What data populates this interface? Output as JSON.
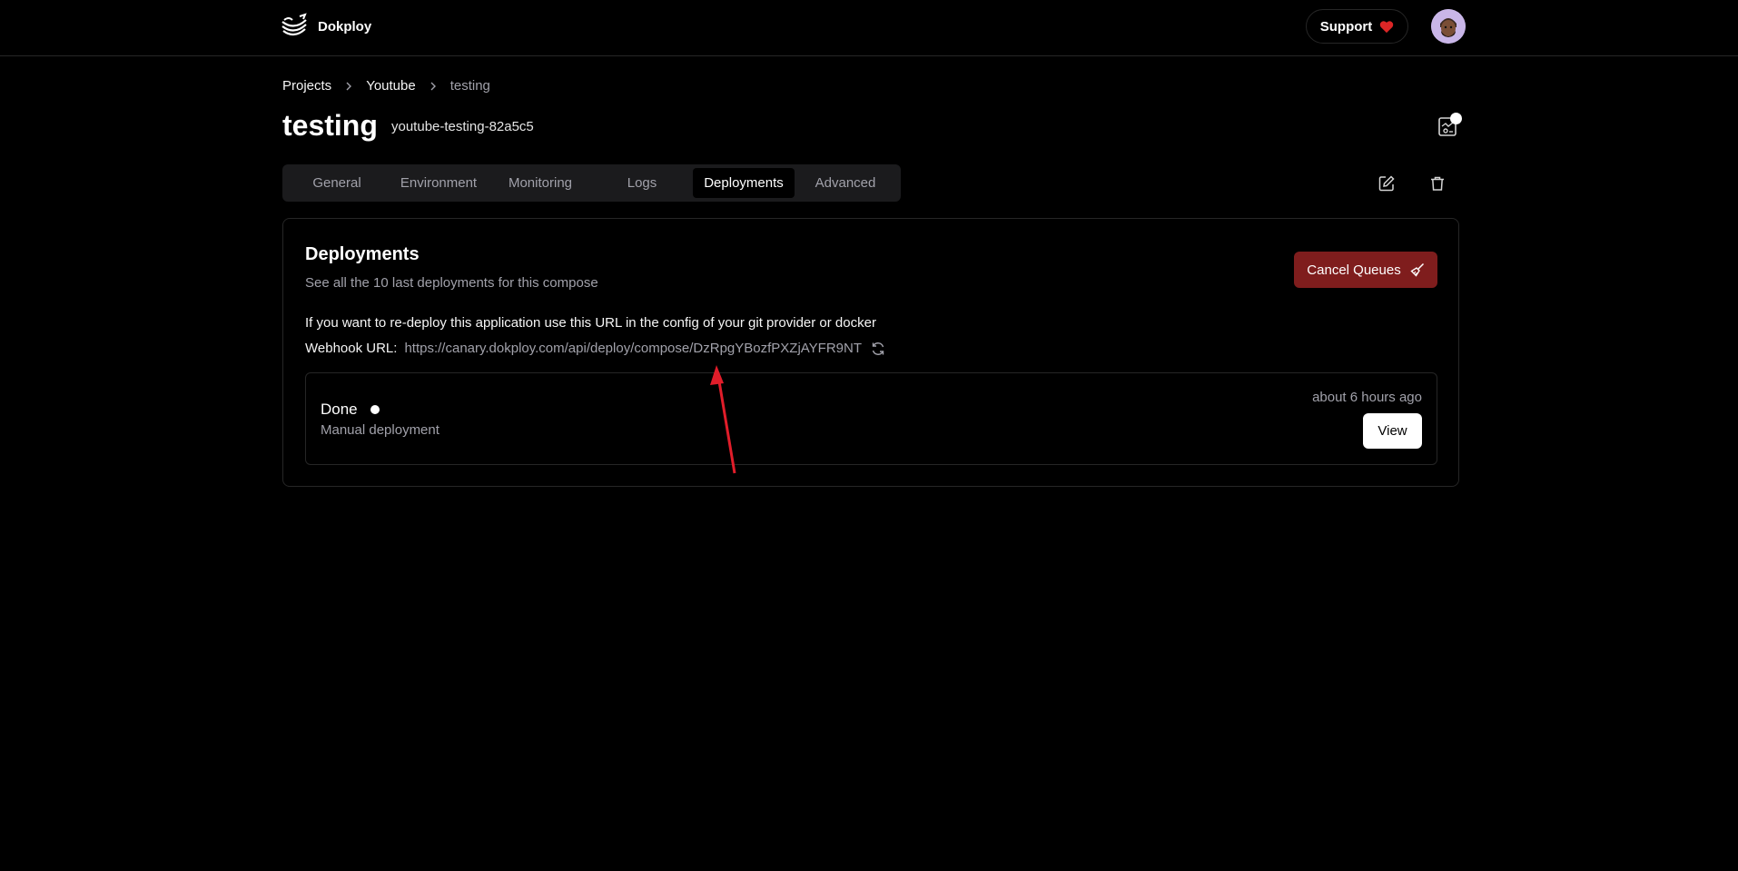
{
  "header": {
    "brand_name": "Dokploy",
    "support_label": "Support"
  },
  "breadcrumb": [
    {
      "label": "Projects"
    },
    {
      "label": "Youtube"
    },
    {
      "label": "testing"
    }
  ],
  "page": {
    "title": "testing",
    "app_name": "youtube-testing-82a5c5"
  },
  "tabs": [
    {
      "label": "General"
    },
    {
      "label": "Environment"
    },
    {
      "label": "Monitoring"
    },
    {
      "label": "Logs"
    },
    {
      "label": "Deployments",
      "active": true
    },
    {
      "label": "Advanced"
    }
  ],
  "deployments_card": {
    "title": "Deployments",
    "description": "See all the 10 last deployments for this compose",
    "cancel_label": "Cancel Queues",
    "info_text": "If you want to re-deploy this application use this URL in the config of your git provider or docker",
    "webhook_label": "Webhook URL:",
    "webhook_url": "https://canary.dokploy.com/api/deploy/compose/DzRpgYBozfPXZjAYFR9NT",
    "items": [
      {
        "status": "Done",
        "type": "Manual deployment",
        "time": "about 6 hours ago",
        "view_label": "View"
      }
    ]
  },
  "colors": {
    "background": "#000000",
    "danger": "#7f1d1d",
    "heart": "#dc2626",
    "annotation": "#e11d2a",
    "muted_text": "#a1a1aa",
    "border": "#262626"
  },
  "icons": {
    "brand": "dokploy-logo-icon",
    "support": "heart-icon",
    "breadcrumb_separator": "chevron-right-icon",
    "stats": "monitor-stats-icon",
    "edit": "edit-icon",
    "delete": "trash-icon",
    "cancel": "broom-icon",
    "refresh": "refresh-icon"
  }
}
